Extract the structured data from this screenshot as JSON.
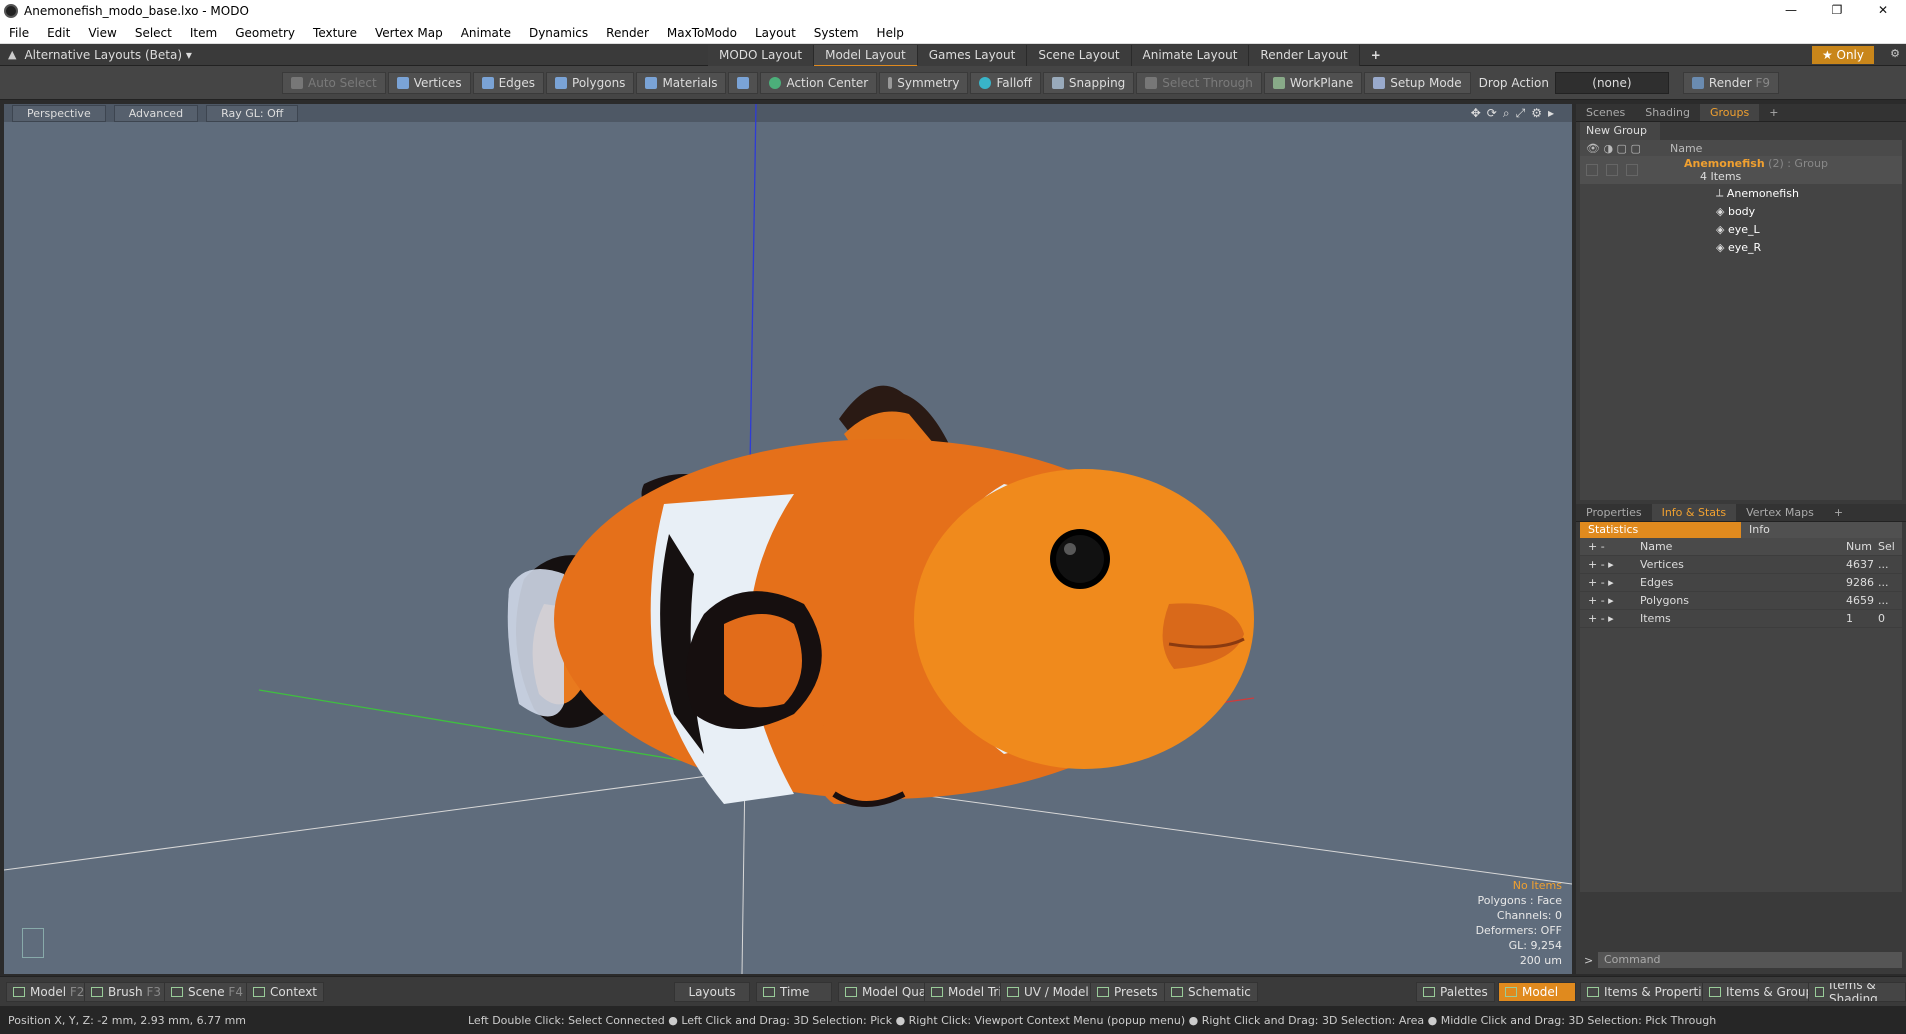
{
  "window": {
    "title": "Anemonefish_modo_base.lxo - MODO"
  },
  "menu": [
    "File",
    "Edit",
    "View",
    "Select",
    "Item",
    "Geometry",
    "Texture",
    "Vertex Map",
    "Animate",
    "Dynamics",
    "Render",
    "MaxToModo",
    "Layout",
    "System",
    "Help"
  ],
  "layoutbar": {
    "alt_layouts": "Alternative Layouts (Beta) ▾",
    "tabs": [
      "MODO Layout",
      "Model Layout",
      "Games Layout",
      "Scene Layout",
      "Animate Layout",
      "Render Layout"
    ],
    "active_tab": "Model Layout",
    "add": "+",
    "only": "★ Only"
  },
  "toolbar": {
    "auto_select": "Auto Select",
    "vertices": "Vertices",
    "edges": "Edges",
    "polygons": "Polygons",
    "materials": "Materials",
    "action_center": "Action Center",
    "symmetry": "Symmetry",
    "falloff": "Falloff",
    "snapping": "Snapping",
    "select_through": "Select Through",
    "workplane": "WorkPlane",
    "setup_mode": "Setup Mode",
    "drop_action": "Drop Action",
    "drop_value": "(none)",
    "render": "Render",
    "render_key": "F9"
  },
  "viewport": {
    "perspective": "Perspective",
    "advanced": "Advanced",
    "raygl": "Ray GL: Off",
    "info": {
      "no_items": "No Items",
      "polygons": "Polygons : Face",
      "channels": "Channels: 0",
      "deformers": "Deformers: OFF",
      "gl": "GL: 9,254",
      "scale": "200 um"
    }
  },
  "groups_panel": {
    "tabs": [
      "Scenes",
      "Shading",
      "Groups"
    ],
    "active": "Groups",
    "new_group": "New Group",
    "col_name": "Name",
    "group_name": "Anemonefish",
    "group_sub": "(2) : Group",
    "group_count": "4 Items",
    "items": [
      "Anemonefish",
      "body",
      "eye_L",
      "eye_R"
    ]
  },
  "stats_panel": {
    "tabs": [
      "Properties",
      "Info & Stats",
      "Vertex Maps"
    ],
    "active": "Info & Stats",
    "sub_tabs": [
      "Statistics",
      "Info"
    ],
    "col_name": "Name",
    "col_num": "Num",
    "col_sel": "Sel",
    "rows": [
      {
        "name": "Vertices",
        "num": "4637",
        "sel": "..."
      },
      {
        "name": "Edges",
        "num": "9286",
        "sel": "..."
      },
      {
        "name": "Polygons",
        "num": "4659",
        "sel": "..."
      },
      {
        "name": "Items",
        "num": "1",
        "sel": "0"
      }
    ],
    "command_placeholder": "Command"
  },
  "bottombar": {
    "model": "Model",
    "model_key": "F2",
    "brush": "Brush",
    "brush_key": "F3",
    "scene": "Scene",
    "scene_key": "F4",
    "context": "Context",
    "layouts": "Layouts",
    "time": "Time",
    "model_quad": "Model Quad",
    "model_tri": "Model Tri",
    "uv_model": "UV / Model",
    "presets": "Presets",
    "schematic": "Schematic",
    "palettes": "Palettes",
    "model_active": "Model",
    "items_props": "Items & Properties",
    "items_groups": "Items & Groups",
    "items_shading": "Items & Shading"
  },
  "status": {
    "position": "Position X, Y, Z:   -2 mm, 2.93 mm, 6.77 mm",
    "hint": "Left Double Click: Select Connected ● Left Click and Drag: 3D Selection: Pick ● Right Click: Viewport Context Menu (popup menu) ● Right Click and Drag: 3D Selection: Area ● Middle Click and Drag: 3D Selection: Pick Through"
  }
}
